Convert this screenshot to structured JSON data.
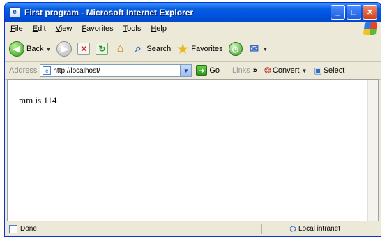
{
  "window": {
    "title": "First program - Microsoft Internet Explorer",
    "app_icon_glyph": "e",
    "controls": {
      "minimize": "_",
      "maximize": "□",
      "close": "✕"
    }
  },
  "menubar": {
    "items": [
      "File",
      "Edit",
      "View",
      "Favorites",
      "Tools",
      "Help"
    ]
  },
  "toolbar": {
    "back_label": "Back",
    "search_label": "Search",
    "favorites_label": "Favorites",
    "icons": [
      "back-icon",
      "forward-icon",
      "stop-icon",
      "refresh-icon",
      "home-icon",
      "search-icon",
      "favorites-icon",
      "history-icon",
      "mail-icon"
    ]
  },
  "addressbar": {
    "label": "Address",
    "url": "http://localhost/",
    "go_label": "Go",
    "links_label": "Links",
    "convert_label": "Convert",
    "select_label": "Select"
  },
  "content": {
    "text": "mm is 114"
  },
  "statusbar": {
    "status": "Done",
    "zone": "Local intranet"
  }
}
